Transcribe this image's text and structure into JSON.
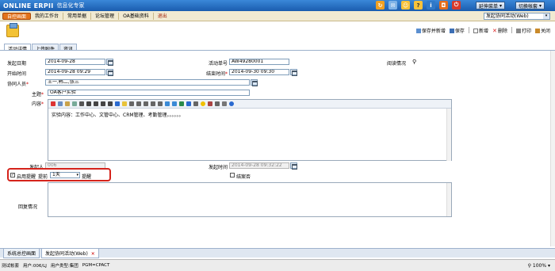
{
  "app": {
    "logo": "ONLINE ERPII",
    "logo_sub": "信息化专家",
    "top_buttons": {
      "shortcut_menu": "延伸菜单",
      "switch_account": "切换帐套"
    }
  },
  "nav": {
    "items": [
      "自控画面",
      "我的工作台",
      "常用单据",
      "论坛管理",
      "OA基础资料",
      "退出"
    ],
    "module_select": "发起协同活动(Web)"
  },
  "toolbar": {
    "save_add": "保存并新增",
    "save": "保存",
    "new": "新增",
    "delete": "删除",
    "print": "打印",
    "close": "关闭"
  },
  "tabs": [
    "活动详情",
    "上传附件",
    "资讯"
  ],
  "form": {
    "start_date_label": "发起日期",
    "start_date": "2014-09-28",
    "activity_no_label": "活动单号",
    "activity_no": "AW49280001",
    "read_status_label": "阅读情况",
    "begin_time_label": "开始时间",
    "begin_time": "2014-09-28 09:29",
    "end_time_label": "结束时间",
    "end_time": "2014-09-30 09:30",
    "participants_label": "协同人员",
    "participants": "王一,韩二,张三",
    "subject_label": "主题",
    "subject": "OA客户实验",
    "content_label": "内容",
    "content": "实验内容：工作中心、文管中心、CRM管理、考勤管理。。。。。。",
    "initiator_label": "发起人",
    "initiator": "006",
    "initiate_time_label": "发起时间",
    "initiate_time": "2014-09-28 09:32:22",
    "enable_reminder_label": "启用提醒",
    "remind_before_label": "提前",
    "remind_value": "1天",
    "remind_after_label": "提醒",
    "finished_label": "结案否",
    "reply_label": "回复情况"
  },
  "bottom_tabs": [
    "系统总控画面",
    "发起协同活动(Web)"
  ],
  "status": {
    "test": "测试帐套",
    "user": "用户:006/LJ",
    "user_type": "用户类型:集团",
    "pgm": "PGM=CPACT",
    "zoom": "100%"
  }
}
